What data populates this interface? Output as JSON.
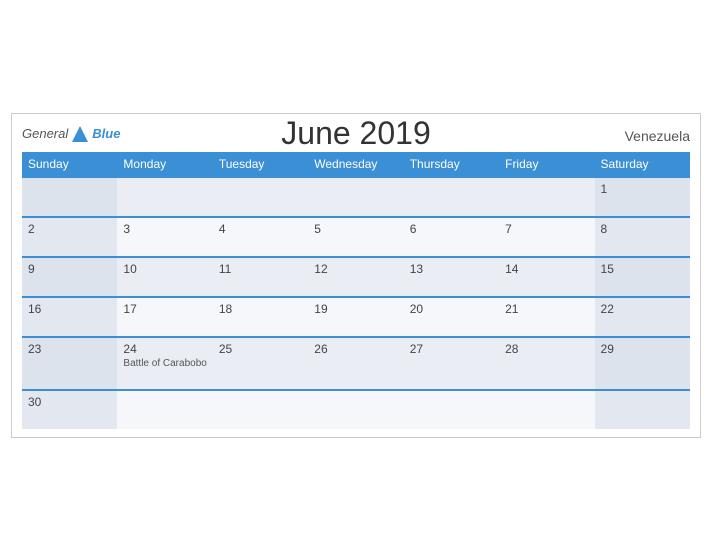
{
  "header": {
    "title": "June 2019",
    "country": "Venezuela",
    "logo_general": "General",
    "logo_blue": "Blue"
  },
  "days_of_week": [
    "Sunday",
    "Monday",
    "Tuesday",
    "Wednesday",
    "Thursday",
    "Friday",
    "Saturday"
  ],
  "weeks": [
    [
      {
        "day": "",
        "event": ""
      },
      {
        "day": "",
        "event": ""
      },
      {
        "day": "",
        "event": ""
      },
      {
        "day": "",
        "event": ""
      },
      {
        "day": "",
        "event": ""
      },
      {
        "day": "",
        "event": ""
      },
      {
        "day": "1",
        "event": ""
      }
    ],
    [
      {
        "day": "2",
        "event": ""
      },
      {
        "day": "3",
        "event": ""
      },
      {
        "day": "4",
        "event": ""
      },
      {
        "day": "5",
        "event": ""
      },
      {
        "day": "6",
        "event": ""
      },
      {
        "day": "7",
        "event": ""
      },
      {
        "day": "8",
        "event": ""
      }
    ],
    [
      {
        "day": "9",
        "event": ""
      },
      {
        "day": "10",
        "event": ""
      },
      {
        "day": "11",
        "event": ""
      },
      {
        "day": "12",
        "event": ""
      },
      {
        "day": "13",
        "event": ""
      },
      {
        "day": "14",
        "event": ""
      },
      {
        "day": "15",
        "event": ""
      }
    ],
    [
      {
        "day": "16",
        "event": ""
      },
      {
        "day": "17",
        "event": ""
      },
      {
        "day": "18",
        "event": ""
      },
      {
        "day": "19",
        "event": ""
      },
      {
        "day": "20",
        "event": ""
      },
      {
        "day": "21",
        "event": ""
      },
      {
        "day": "22",
        "event": ""
      }
    ],
    [
      {
        "day": "23",
        "event": ""
      },
      {
        "day": "24",
        "event": "Battle of Carabobo"
      },
      {
        "day": "25",
        "event": ""
      },
      {
        "day": "26",
        "event": ""
      },
      {
        "day": "27",
        "event": ""
      },
      {
        "day": "28",
        "event": ""
      },
      {
        "day": "29",
        "event": ""
      }
    ],
    [
      {
        "day": "30",
        "event": ""
      },
      {
        "day": "",
        "event": ""
      },
      {
        "day": "",
        "event": ""
      },
      {
        "day": "",
        "event": ""
      },
      {
        "day": "",
        "event": ""
      },
      {
        "day": "",
        "event": ""
      },
      {
        "day": "",
        "event": ""
      }
    ]
  ]
}
